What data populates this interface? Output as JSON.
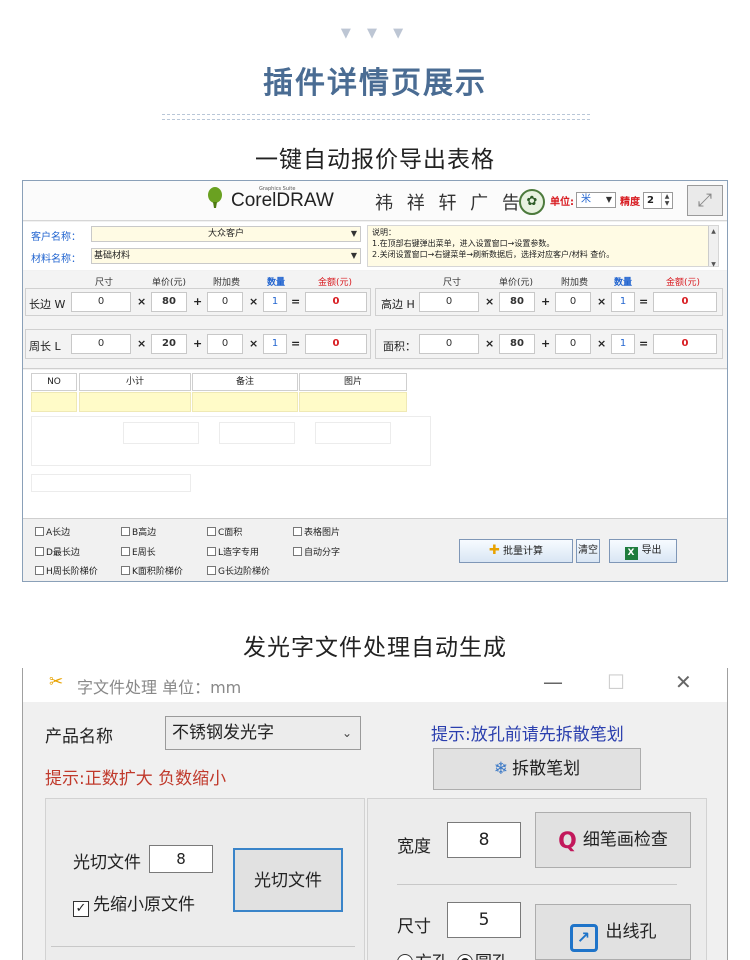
{
  "header": {
    "chevrons": "▼ ▼ ▼",
    "title": "插件详情页展示",
    "section1": "一键自动报价导出表格",
    "section2": "发光字文件处理自动生成"
  },
  "quote_window": {
    "brand": {
      "corel_small": "Graphics Suite",
      "corel_text": "CorelDRAW",
      "cn_name": "祎 祥 轩 广 告",
      "badge": "✿"
    },
    "unit_label": "单位:",
    "unit_value": "米",
    "precision_label": "精度",
    "precision_value": "2",
    "expand_icon": "⤢",
    "customer_label": "客户名称：",
    "customer_value": "大众客户",
    "material_label": "材料名称：",
    "material_value": "基础材料",
    "note": {
      "title": "说明：",
      "line1": "1.在顶部右键弹出菜单，进入设置窗口→设置参数。",
      "line2": "2.关闭设置窗口→右键菜单→刷新数据后，选择对应客户/材料 查价。"
    },
    "col_headers": {
      "size": "尺寸",
      "unit_price": "单价(元)",
      "extra": "附加费",
      "qty": "数量",
      "amount": "金额(元)"
    },
    "rows": {
      "long_w": {
        "label": "长边 W",
        "size": "0",
        "price": "80",
        "extra": "0",
        "qty": "1",
        "amount": "0"
      },
      "high_h": {
        "label": "高边 H",
        "size": "0",
        "price": "80",
        "extra": "0",
        "qty": "1",
        "amount": "0"
      },
      "perim_l": {
        "label": "周长 L",
        "size": "0",
        "price": "20",
        "extra": "0",
        "qty": "1",
        "amount": "0"
      },
      "area": {
        "label": "面积：",
        "size": "0",
        "price": "80",
        "extra": "0",
        "qty": "1",
        "amount": "0"
      }
    },
    "ops": {
      "times": "×",
      "plus": "+",
      "equals": "="
    },
    "table_headers": {
      "no": "NO",
      "subtotal": "小计",
      "remark": "备注",
      "image": "图片"
    },
    "checkboxes": {
      "a": "A长边",
      "b": "B高边",
      "c": "C面积",
      "table_img": "表格图片",
      "d": "D最长边",
      "e": "E周长",
      "l": "L造字专用",
      "auto_split": "自动分字",
      "h": "H周长阶梯价",
      "k": "K面积阶梯价",
      "g": "G长边阶梯价"
    },
    "buttons": {
      "batch": "批量计算",
      "clear": "清空",
      "export": "导出"
    }
  },
  "glow_window": {
    "title": "字文件处理  单位：mm",
    "title_icon": "✂",
    "window_controls": {
      "min": "—",
      "max": "☐",
      "close": "✕"
    },
    "product_label": "产品名称",
    "product_value": "不锈钢发光字",
    "hint_red": "提示:正数扩大 负数缩小",
    "hint_blue": "提示:放孔前请先拆散笔划",
    "split_button": "拆散笔划",
    "laser_label": "光切文件",
    "laser_value": "8",
    "shrink_checkbox": "先缩小原文件",
    "laser_button": "光切文件",
    "width_label": "宽度",
    "width_value": "8",
    "thin_check_button": "细笔画检查",
    "size_label": "尺寸",
    "size_value": "5",
    "outline_button": "出线孔",
    "radio_square": "方孔",
    "radio_round": "圆孔"
  },
  "colors": {
    "title_blue": "#4a6c93",
    "accent_red": "#d81b20",
    "accent_blue": "#2466d0",
    "hint_red": "#c0392b",
    "hint_blue": "#2b3fae"
  }
}
